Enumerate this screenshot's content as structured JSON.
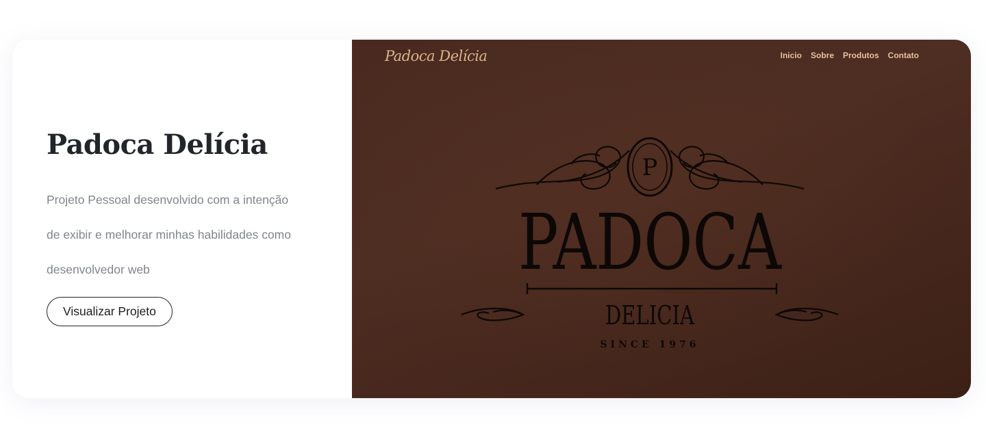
{
  "project": {
    "title": "Padoca Delícia",
    "description_lines": [
      "Projeto Pessoal desenvolvido com a intenção",
      "de exibir e melhorar minhas habilidades como",
      "desenvolvedor web"
    ],
    "cta_label": "Visualizar Projeto"
  },
  "preview": {
    "logo": "Padoca Delícia",
    "nav": [
      "Inicio",
      "Sobre",
      "Produtos",
      "Contato"
    ],
    "emblem": {
      "monogram": "P",
      "word": "PADOCA",
      "sub": "DELICIA",
      "since": "SINCE 1976"
    },
    "colors": {
      "background": "#4a2a20",
      "accent": "#e4c19c",
      "emblem_ink": "#0d0806"
    }
  }
}
